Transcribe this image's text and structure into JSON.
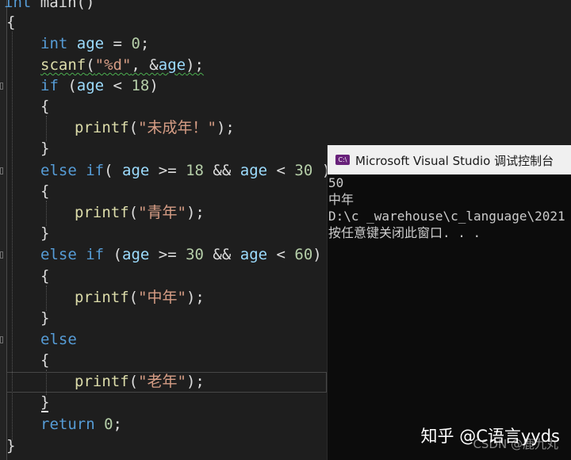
{
  "editor": {
    "lines": {
      "l0": {
        "a": "int",
        "b": " main()"
      },
      "l1": {
        "a": "{"
      },
      "l2": {
        "a": "int",
        "b": " ",
        "c": "age",
        "d": " = ",
        "e": "0",
        "f": ";"
      },
      "l3": {
        "a": "scanf",
        "b": "(",
        "c": "\"%d\"",
        "d": ", &",
        "e": "age",
        "f": ");"
      },
      "l4": {
        "a": "if",
        "b": " (",
        "c": "age",
        "d": " < ",
        "e": "18",
        "f": ")"
      },
      "l5": {
        "a": "{"
      },
      "l6": {
        "a": "printf",
        "b": "(",
        "c": "\"未成年！\"",
        "d": ");"
      },
      "l7": {
        "a": "}"
      },
      "l8": {
        "a": "else",
        "b": " ",
        "c": "if",
        "d": "( ",
        "e": "age",
        "f": " >= ",
        "g": "18",
        "h": " && ",
        "i": "age",
        "j": " < ",
        "k": "30",
        "l": " )"
      },
      "l9": {
        "a": "{"
      },
      "l10": {
        "a": "printf",
        "b": "(",
        "c": "\"青年\"",
        "d": ");"
      },
      "l11": {
        "a": "}"
      },
      "l12": {
        "a": "else",
        "b": " ",
        "c": "if",
        "d": " (",
        "e": "age",
        "f": " >= ",
        "g": "30",
        "h": " && ",
        "i": "age",
        "j": " < ",
        "k": "60",
        "l": ")"
      },
      "l13": {
        "a": "{"
      },
      "l14": {
        "a": "printf",
        "b": "(",
        "c": "\"中年\"",
        "d": ");"
      },
      "l15": {
        "a": "}"
      },
      "l16": {
        "a": "else"
      },
      "l17": {
        "a": "{"
      },
      "l18": {
        "a": "printf",
        "b": "(",
        "c": "\"老年\"",
        "d": ");"
      },
      "l19": {
        "a": "}"
      },
      "l20": {
        "a": "return",
        "b": " ",
        "c": "0",
        "d": ";"
      },
      "l21": {
        "a": "}"
      }
    }
  },
  "console": {
    "icon": "vs-console-icon",
    "title": "Microsoft Visual Studio 调试控制台",
    "output": [
      "50",
      "中年",
      "D:\\c _warehouse\\c_language\\2021",
      "按任意键关闭此窗口. . ."
    ]
  },
  "watermark": {
    "line1": "知乎 @C语言yyds",
    "line2": "CSDN @鹿九丸"
  },
  "colors": {
    "keyword": "#569cd6",
    "variable": "#9cdcfe",
    "function": "#dcdcaa",
    "string": "#d69d85",
    "number": "#b5cea8"
  }
}
